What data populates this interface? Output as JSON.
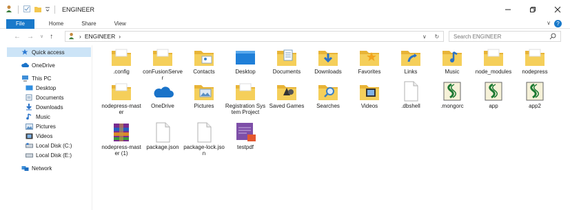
{
  "window": {
    "title": "ENGINEER"
  },
  "ribbon": {
    "tabs": [
      "File",
      "Home",
      "Share",
      "View"
    ]
  },
  "address": {
    "crumbs": [
      "ENGINEER"
    ]
  },
  "search": {
    "placeholder": "Search ENGINEER"
  },
  "sidebar": {
    "items": [
      {
        "label": "Quick access",
        "icon": "star-icon",
        "selected": true
      },
      {
        "label": "OneDrive",
        "icon": "cloud-icon"
      },
      {
        "label": "This PC",
        "icon": "computer-icon"
      },
      {
        "label": "Desktop",
        "icon": "desktop-icon"
      },
      {
        "label": "Documents",
        "icon": "documents-icon"
      },
      {
        "label": "Downloads",
        "icon": "download-icon"
      },
      {
        "label": "Music",
        "icon": "music-icon"
      },
      {
        "label": "Pictures",
        "icon": "pictures-icon"
      },
      {
        "label": "Videos",
        "icon": "videos-icon"
      },
      {
        "label": "Local Disk (C:)",
        "icon": "drive-icon"
      },
      {
        "label": "Local Disk (E:)",
        "icon": "drive-icon"
      },
      {
        "label": "Network",
        "icon": "network-icon"
      }
    ]
  },
  "files": [
    {
      "label": ".config",
      "icon": "folder-icon"
    },
    {
      "label": "conFusionServer",
      "icon": "folder-icon"
    },
    {
      "label": "Contacts",
      "icon": "contacts-folder-icon"
    },
    {
      "label": "Desktop",
      "icon": "desktop-folder-icon"
    },
    {
      "label": "Documents",
      "icon": "documents-folder-icon"
    },
    {
      "label": "Downloads",
      "icon": "downloads-folder-icon"
    },
    {
      "label": "Favorites",
      "icon": "favorites-folder-icon"
    },
    {
      "label": "Links",
      "icon": "links-folder-icon"
    },
    {
      "label": "Music",
      "icon": "music-folder-icon"
    },
    {
      "label": "node_modules",
      "icon": "folder-icon"
    },
    {
      "label": "nodepress",
      "icon": "folder-icon"
    },
    {
      "label": "nodepress-master",
      "icon": "folder-icon"
    },
    {
      "label": "OneDrive",
      "icon": "onedrive-icon"
    },
    {
      "label": "Pictures",
      "icon": "pictures-folder-icon"
    },
    {
      "label": "Registration System Project",
      "icon": "folder-icon"
    },
    {
      "label": "Saved Games",
      "icon": "saved-games-folder-icon"
    },
    {
      "label": "Searches",
      "icon": "searches-folder-icon"
    },
    {
      "label": "Videos",
      "icon": "videos-folder-icon"
    },
    {
      "label": ".dbshell",
      "icon": "file-icon"
    },
    {
      "label": ".mongorc",
      "icon": "script-icon"
    },
    {
      "label": "app",
      "icon": "script-icon"
    },
    {
      "label": "app2",
      "icon": "script-icon"
    },
    {
      "label": "nodepress-master (1)",
      "icon": "archive-icon"
    },
    {
      "label": "package.json",
      "icon": "file-icon"
    },
    {
      "label": "package-lock.json",
      "icon": "file-icon"
    },
    {
      "label": "testpdf",
      "icon": "pdf-icon"
    }
  ],
  "colors": {
    "accent": "#1979ca",
    "folder": "#f3c74f",
    "selection": "#cce4f7"
  }
}
